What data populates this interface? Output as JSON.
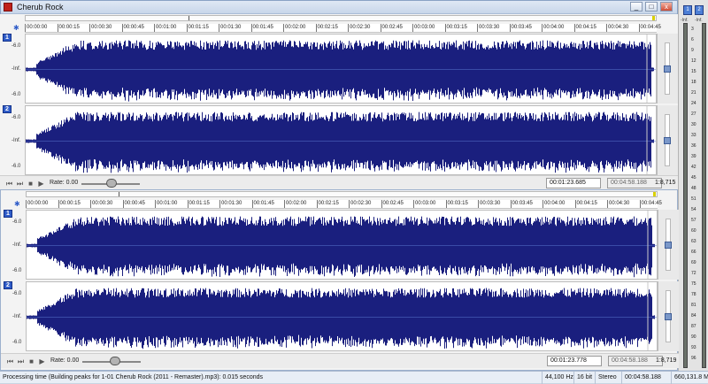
{
  "window": {
    "title": "Cherub Rock",
    "btn_min": "_",
    "btn_max": "□",
    "btn_close": "x"
  },
  "ruler_ticks": [
    "00:00:00",
    "00:00:15",
    "00:00:30",
    "00:00:45",
    "00:01:00",
    "00:01:15",
    "00:01:30",
    "00:01:45",
    "00:02:00",
    "00:02:15",
    "00:02:30",
    "00:02:45",
    "00:03:00",
    "00:03:15",
    "00:03:30",
    "00:03:45",
    "00:04:00",
    "00:04:15",
    "00:04:30",
    "00:04:45"
  ],
  "channels": {
    "ch1": "1",
    "ch2": "2"
  },
  "db_labels": {
    "top": "-6.0",
    "mid": "-Inf.",
    "bottom": "-6.0"
  },
  "panes": [
    {
      "rate_label": "Rate: 0.00",
      "cursor_time": "00:01:23.685",
      "total_time": "00:04:58.188",
      "zoom": "1:8,715"
    },
    {
      "rate_label": "Rate: 0.00",
      "cursor_time": "00:01:23.778",
      "total_time": "00:04:58.188",
      "zoom": "1:8,719"
    }
  ],
  "transport": {
    "go_start": "⏮",
    "go_end": "⏭",
    "stop": "■",
    "play": "▶"
  },
  "meter": {
    "btn1": "1",
    "btn2": "2",
    "inf_left": "-Inf.",
    "inf_right": "-Inf.",
    "scale": [
      "3",
      "6",
      "9",
      "12",
      "15",
      "18",
      "21",
      "24",
      "27",
      "30",
      "33",
      "36",
      "39",
      "42",
      "45",
      "48",
      "51",
      "54",
      "57",
      "60",
      "63",
      "66",
      "69",
      "72",
      "75",
      "78",
      "81",
      "84",
      "87",
      "90",
      "93",
      "96"
    ]
  },
  "statusbar": {
    "message": "Processing time (Building peaks for 1-01 Cherub Rock (2011 - Remaster).mp3): 0.015 seconds",
    "sample_rate": "44,100 Hz",
    "bit_depth": "16 bit",
    "channels": "Stereo",
    "length": "00:04:58.188",
    "file_size": "660,131.8 MB"
  },
  "colors": {
    "waveform": "#1a1f7e",
    "centerline": "#5a79d0",
    "accent": "#2f5cc8"
  }
}
